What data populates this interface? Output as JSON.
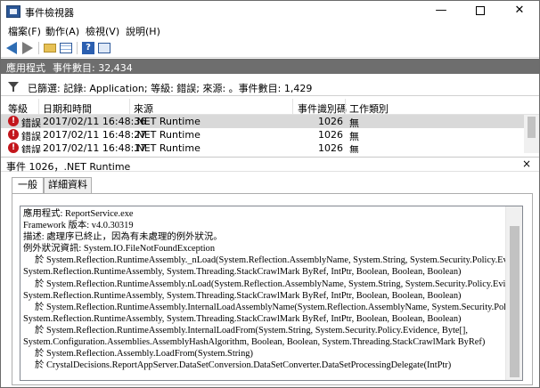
{
  "window": {
    "title": "事件檢視器",
    "min_glyph": "—",
    "close_glyph": "✕"
  },
  "menu": [
    "檔案(F)",
    "動作(A)",
    "檢視(V)",
    "說明(H)"
  ],
  "toolbar": {
    "help_glyph": "?"
  },
  "header": {
    "section": "應用程式",
    "count_label": "事件數目: 32,434"
  },
  "filter": {
    "text": "已篩選: 記錄: Application; 等級: 錯誤; 來源: 。事件數目: 1,429"
  },
  "columns": [
    "等級",
    "日期和時間",
    "來源",
    "事件識別碼",
    "工作類別"
  ],
  "events": [
    {
      "level": "錯誤",
      "datetime": "2017/02/11 16:48:36",
      "source": ".NET Runtime",
      "id": "1026",
      "category": "無"
    },
    {
      "level": "錯誤",
      "datetime": "2017/02/11 16:48:27",
      "source": ".NET Runtime",
      "id": "1026",
      "category": "無"
    },
    {
      "level": "錯誤",
      "datetime": "2017/02/11 16:48:17",
      "source": ".NET Runtime",
      "id": "1026",
      "category": "無"
    }
  ],
  "detail": {
    "title": "事件 1026，.NET Runtime",
    "close_glyph": "×",
    "tabs": [
      "一般",
      "詳細資料"
    ],
    "description": "應用程式: ReportService.exe\nFramework 版本: v4.0.30319\n描述: 處理序已終止，因為有未處理的例外狀況。\n例外狀況資訊: System.IO.FileNotFoundException\n     於 System.Reflection.RuntimeAssembly._nLoad(System.Reflection.AssemblyName, System.String, System.Security.Policy.Evidence,\nSystem.Reflection.RuntimeAssembly, System.Threading.StackCrawlMark ByRef, IntPtr, Boolean, Boolean, Boolean)\n     於 System.Reflection.RuntimeAssembly.nLoad(System.Reflection.AssemblyName, System.String, System.Security.Policy.Evidence,\nSystem.Reflection.RuntimeAssembly, System.Threading.StackCrawlMark ByRef, IntPtr, Boolean, Boolean, Boolean)\n     於 System.Reflection.RuntimeAssembly.InternalLoadAssemblyName(System.Reflection.AssemblyName, System.Security.Policy.Evidence,\nSystem.Reflection.RuntimeAssembly, System.Threading.StackCrawlMark ByRef, IntPtr, Boolean, Boolean, Boolean)\n     於 System.Reflection.RuntimeAssembly.InternalLoadFrom(System.String, System.Security.Policy.Evidence, Byte[],\nSystem.Configuration.Assemblies.AssemblyHashAlgorithm, Boolean, Boolean, System.Threading.StackCrawlMark ByRef)\n     於 System.Reflection.Assembly.LoadFrom(System.String)\n     於 CrystalDecisions.ReportAppServer.DataSetConversion.DataSetConverter.DataSetProcessingDelegate(IntPtr)"
  },
  "colors": {
    "header_gray": "#6e6e6e",
    "error_red": "#c3161c",
    "selected_row": "#d9d9d9"
  }
}
